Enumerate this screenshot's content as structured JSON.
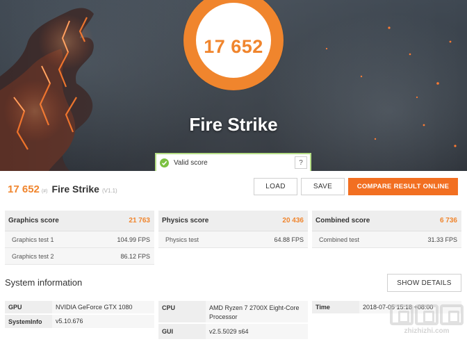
{
  "hero": {
    "score": "17 652",
    "benchmark_title": "Fire Strike",
    "valid_label": "Valid score",
    "help_label": "?"
  },
  "result": {
    "score": "17 652",
    "score_suffix": "(#)",
    "name": "Fire Strike",
    "version": "(V1.1)"
  },
  "actions": {
    "load": "LOAD",
    "save": "SAVE",
    "compare": "COMPARE RESULT ONLINE"
  },
  "panels": [
    {
      "title": "Graphics score",
      "value": "21 763",
      "rows": [
        {
          "label": "Graphics test 1",
          "value": "104.99 FPS"
        },
        {
          "label": "Graphics test 2",
          "value": "86.12 FPS"
        }
      ]
    },
    {
      "title": "Physics score",
      "value": "20 436",
      "rows": [
        {
          "label": "Physics test",
          "value": "64.88 FPS"
        }
      ]
    },
    {
      "title": "Combined score",
      "value": "6 736",
      "rows": [
        {
          "label": "Combined test",
          "value": "31.33 FPS"
        }
      ]
    }
  ],
  "system": {
    "title": "System information",
    "details_button": "SHOW DETAILS",
    "col1": [
      {
        "key": "GPU",
        "value": "NVIDIA GeForce GTX 1080"
      },
      {
        "key": "SystemInfo",
        "value": "v5.10.676"
      }
    ],
    "col2": [
      {
        "key": "CPU",
        "value": "AMD Ryzen 7 2700X Eight-Core Processor"
      },
      {
        "key": "GUI",
        "value": "v2.5.5029 s64"
      }
    ],
    "col3": [
      {
        "key": "Time",
        "value": "2018-07-05 15:18 +08:00"
      }
    ]
  },
  "watermark": {
    "text": "zhizhizhi.com"
  },
  "colors": {
    "accent": "#f0852d",
    "compare_button": "#f26f21",
    "valid_green": "#7cc142"
  }
}
